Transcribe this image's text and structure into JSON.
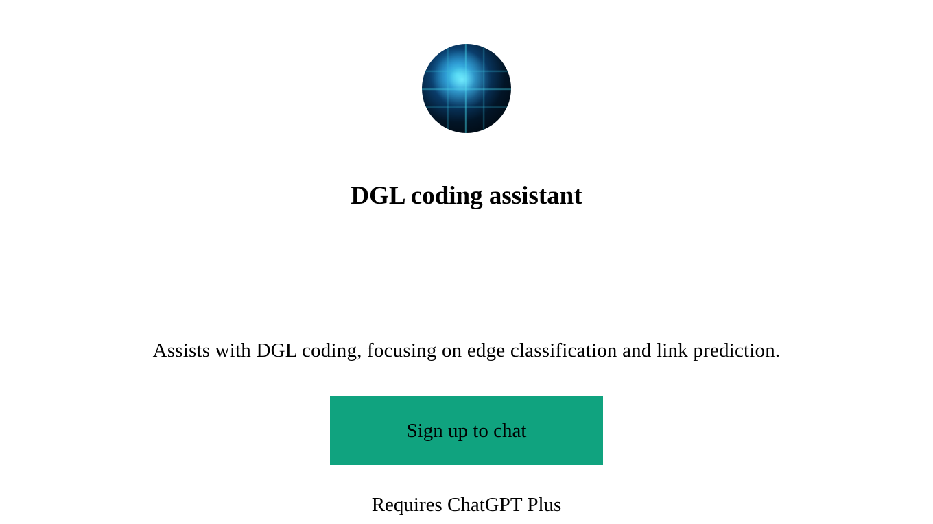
{
  "title": "DGL coding assistant",
  "description": "Assists with DGL coding, focusing on edge classification and link prediction.",
  "signup_button_label": "Sign up to chat",
  "requires_text": "Requires ChatGPT Plus"
}
